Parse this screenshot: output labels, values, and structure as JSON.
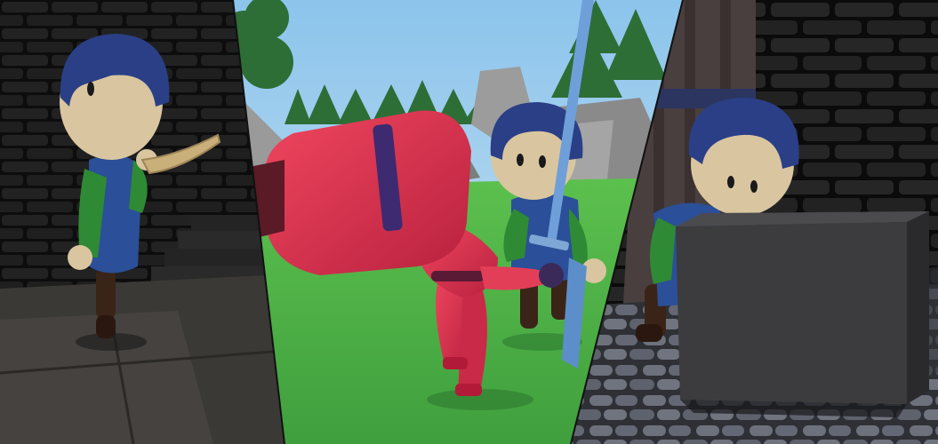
{
  "image": {
    "kind": "game-promotional-collage",
    "panel_count": 3
  },
  "panels": [
    {
      "id": "left",
      "scene": "dungeon-stone-wall",
      "subject": "blue-helmet-hero-blowing-horn"
    },
    {
      "id": "center",
      "scene": "forest-meadow",
      "subject": "red-knight-and-blue-helmet-hero-with-sword"
    },
    {
      "id": "right",
      "scene": "castle-courtyard",
      "subject": "blue-helmet-hero-hiding-behind-crate"
    }
  ],
  "colors": {
    "stone_dark": "#1e1e1e",
    "stone_edge": "#0c0c0c",
    "floor_dark": "#3a3836",
    "sky": "#a9d3ef",
    "grass": "#4fb34a",
    "tree": "#2d6e36",
    "rock": "#8c8c8c",
    "helmet_blue": "#2a3f86",
    "skin": "#d9c6a0",
    "tunic_green": "#2f8a35",
    "knight_red": "#d8324e",
    "sword_blue": "#6f9fd8",
    "crate": "#3c3c3e",
    "cobble": "#6a6e78"
  }
}
